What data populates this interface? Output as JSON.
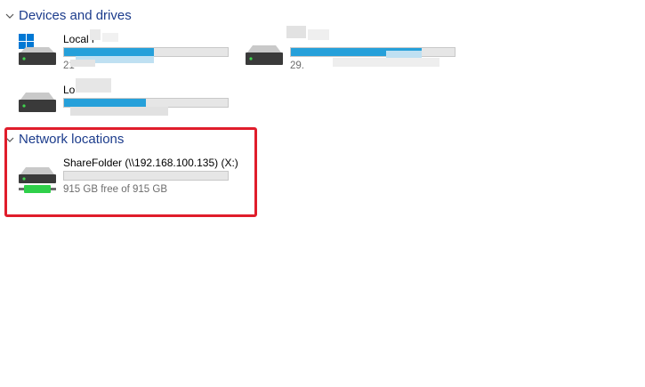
{
  "sections": {
    "devices_title": "Devices and drives",
    "network_title": "Network locations"
  },
  "drives": [
    {
      "name": "Local l",
      "meta": "21",
      "fill": 0.55
    },
    {
      "name": "",
      "meta": "29.",
      "fill": 0.8
    },
    {
      "name": "Lo",
      "meta": "",
      "fill": 0.5
    }
  ],
  "network": [
    {
      "name": "ShareFolder (\\\\192.168.100.135) (X:)",
      "meta": "915 GB free of 915 GB",
      "fill": 0.0
    }
  ],
  "colors": {
    "accent": "#26a0da",
    "header": "#1c3c8c",
    "highlight": "#e01d2b",
    "network_drive_led": "#2fd04a"
  },
  "icons": {
    "chevron": "chevron-down-icon",
    "windows": "windows-logo-icon",
    "drive": "hard-drive-icon",
    "network_drive": "network-drive-icon"
  }
}
